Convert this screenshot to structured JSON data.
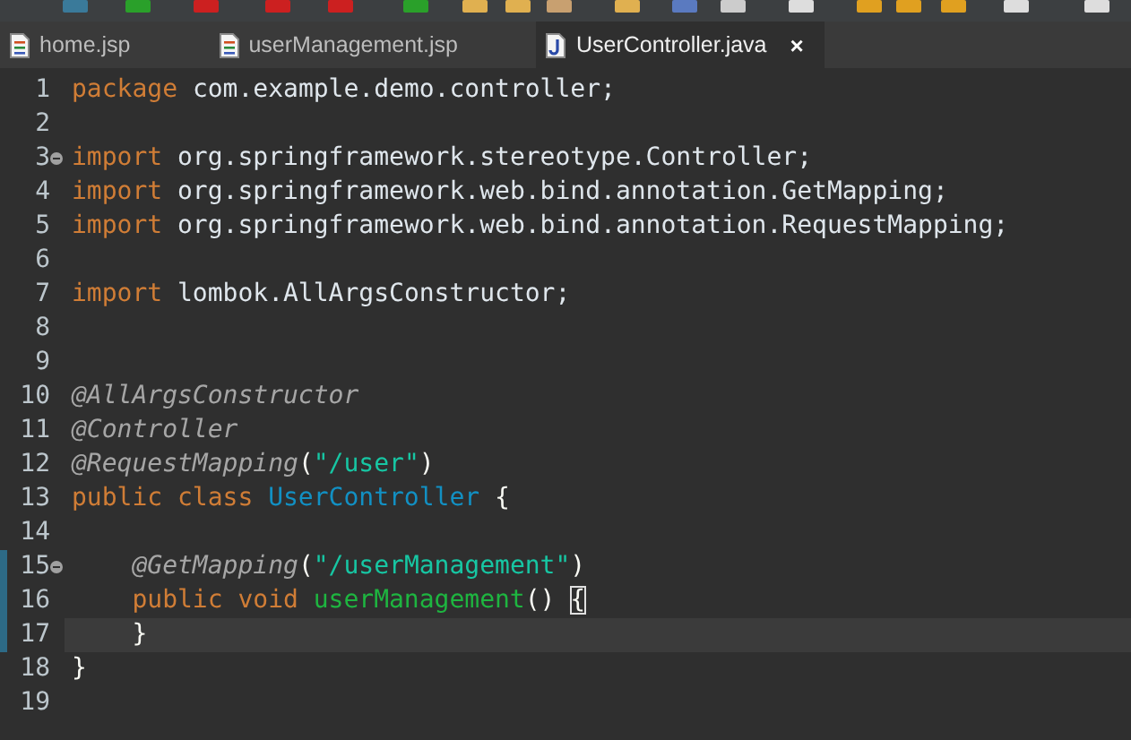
{
  "tabs": [
    {
      "label": "home.jsp",
      "kind": "document",
      "selected": false
    },
    {
      "label": "userManagement.jsp",
      "kind": "document",
      "selected": false
    },
    {
      "label": "UserController.java",
      "kind": "java",
      "selected": true,
      "close": "×"
    }
  ],
  "editor": {
    "lines": [
      {
        "number": "1",
        "fold": false,
        "changed": false,
        "current": false,
        "tokens": [
          {
            "kind": "keyword",
            "text": "package"
          },
          {
            "kind": "plain",
            "text": " com.example.demo.controller;"
          }
        ]
      },
      {
        "number": "2",
        "fold": false,
        "changed": false,
        "current": false
      },
      {
        "number": "3",
        "fold": true,
        "changed": false,
        "current": false,
        "tokens": [
          {
            "kind": "keyword",
            "text": "import"
          },
          {
            "kind": "plain",
            "text": " org.springframework.stereotype.Controller;"
          }
        ]
      },
      {
        "number": "4",
        "fold": false,
        "changed": false,
        "current": false,
        "tokens": [
          {
            "kind": "keyword",
            "text": "import"
          },
          {
            "kind": "plain",
            "text": " org.springframework.web.bind.annotation.GetMapping;"
          }
        ]
      },
      {
        "number": "5",
        "fold": false,
        "changed": false,
        "current": false,
        "tokens": [
          {
            "kind": "keyword",
            "text": "import"
          },
          {
            "kind": "plain",
            "text": " org.springframework.web.bind.annotation.RequestMapping;"
          }
        ]
      },
      {
        "number": "6",
        "fold": false,
        "changed": false,
        "current": false
      },
      {
        "number": "7",
        "fold": false,
        "changed": false,
        "current": false,
        "tokens": [
          {
            "kind": "keyword",
            "text": "import"
          },
          {
            "kind": "plain",
            "text": " lombok.AllArgsConstructor;"
          }
        ]
      },
      {
        "number": "8",
        "fold": false,
        "changed": false,
        "current": false
      },
      {
        "number": "9",
        "fold": false,
        "changed": false,
        "current": false
      },
      {
        "number": "10",
        "fold": false,
        "changed": false,
        "current": false,
        "tokens": [
          {
            "kind": "annotation",
            "text": "@AllArgsConstructor"
          }
        ]
      },
      {
        "number": "11",
        "fold": false,
        "changed": false,
        "current": false,
        "tokens": [
          {
            "kind": "annotation",
            "text": "@Controller"
          }
        ]
      },
      {
        "number": "12",
        "fold": false,
        "changed": false,
        "current": false,
        "tokens": [
          {
            "kind": "annotation",
            "text": "@RequestMapping"
          },
          {
            "kind": "punct",
            "text": "("
          },
          {
            "kind": "string",
            "text": "\"/user\""
          },
          {
            "kind": "punct",
            "text": ")"
          }
        ]
      },
      {
        "number": "13",
        "fold": false,
        "changed": false,
        "current": false,
        "tokens": [
          {
            "kind": "keyword",
            "text": "public class "
          },
          {
            "kind": "type",
            "text": "UserController "
          },
          {
            "kind": "brace",
            "text": "{"
          }
        ]
      },
      {
        "number": "14",
        "fold": false,
        "changed": false,
        "current": false
      },
      {
        "number": "15",
        "fold": true,
        "changed": true,
        "current": false,
        "tokens": [
          {
            "kind": "annotation",
            "text": "    @GetMapping"
          },
          {
            "kind": "punct",
            "text": "("
          },
          {
            "kind": "string",
            "text": "\"/userManagement\""
          },
          {
            "kind": "punct",
            "text": ")"
          }
        ]
      },
      {
        "number": "16",
        "fold": false,
        "changed": true,
        "current": false,
        "tokens": [
          {
            "kind": "keyword",
            "text": "    public void "
          },
          {
            "kind": "method",
            "text": "userManagement"
          },
          {
            "kind": "punct",
            "text": "() "
          },
          {
            "kind": "bracket-match",
            "text": "{"
          }
        ]
      },
      {
        "number": "17",
        "fold": false,
        "changed": true,
        "current": true,
        "tokens": [
          {
            "kind": "brace",
            "text": "    }"
          }
        ]
      },
      {
        "number": "18",
        "fold": false,
        "changed": false,
        "current": false,
        "tokens": [
          {
            "kind": "brace",
            "text": "}"
          }
        ]
      },
      {
        "number": "19",
        "fold": false,
        "changed": false,
        "current": false
      }
    ]
  }
}
